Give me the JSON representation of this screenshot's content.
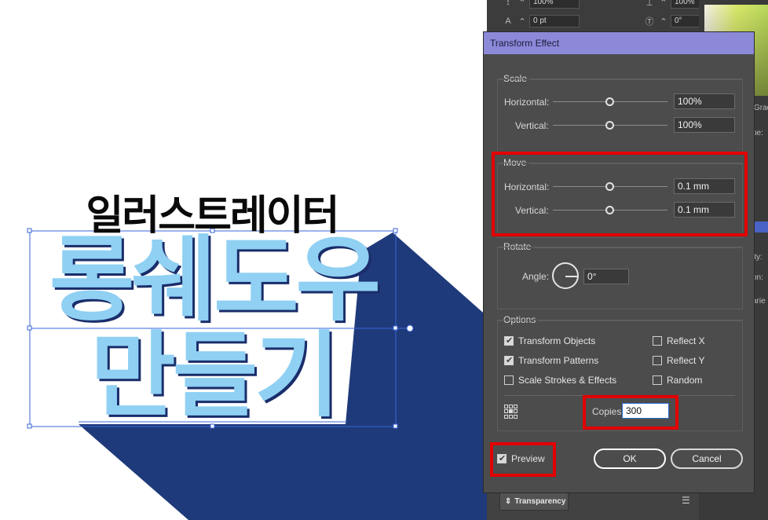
{
  "artwork": {
    "headline": "일러스트레이터",
    "title_line1": "롱쉐도우",
    "title_line2": "만들기",
    "colors": {
      "text": "#8fd0f3",
      "shadow": "#1f3a7a",
      "selection": "#3a66d8"
    }
  },
  "toolbar": {
    "row1": {
      "icon": "leading-icon",
      "value": "100%",
      "right_value": "100%"
    },
    "row2": {
      "icon": "tracking-icon",
      "value": "0 pt",
      "right_icon": "rotate-char-icon",
      "right_value": "0°"
    }
  },
  "side_panel": {
    "label_1": "Gradi",
    "label_2": "pe:",
    "label_3": "ity:",
    "label_4": "on:",
    "label_5": "arie"
  },
  "bottom_panel": {
    "tab_label": "Transparency"
  },
  "dialog": {
    "title": "Transform Effect",
    "scale": {
      "title": "Scale",
      "horizontal_label": "Horizontal:",
      "horizontal_value": "100%",
      "vertical_label": "Vertical:",
      "vertical_value": "100%"
    },
    "move": {
      "title": "Move",
      "horizontal_label": "Horizontal:",
      "horizontal_value": "0.1 mm",
      "vertical_label": "Vertical:",
      "vertical_value": "0.1 mm"
    },
    "rotate": {
      "title": "Rotate",
      "angle_label": "Angle:",
      "angle_value": "0°"
    },
    "options": {
      "title": "Options",
      "transform_objects": {
        "label": "Transform Objects",
        "checked": true
      },
      "transform_patterns": {
        "label": "Transform Patterns",
        "checked": true
      },
      "scale_strokes": {
        "label": "Scale Strokes & Effects",
        "checked": false
      },
      "reflect_x": {
        "label": "Reflect X",
        "checked": false
      },
      "reflect_y": {
        "label": "Reflect Y",
        "checked": false
      },
      "random": {
        "label": "Random",
        "checked": false
      }
    },
    "copies": {
      "label": "Copies",
      "value": "300"
    },
    "preview": {
      "label": "Preview",
      "checked": true
    },
    "ok_label": "OK",
    "cancel_label": "Cancel",
    "highlight_color": "#e30000"
  }
}
